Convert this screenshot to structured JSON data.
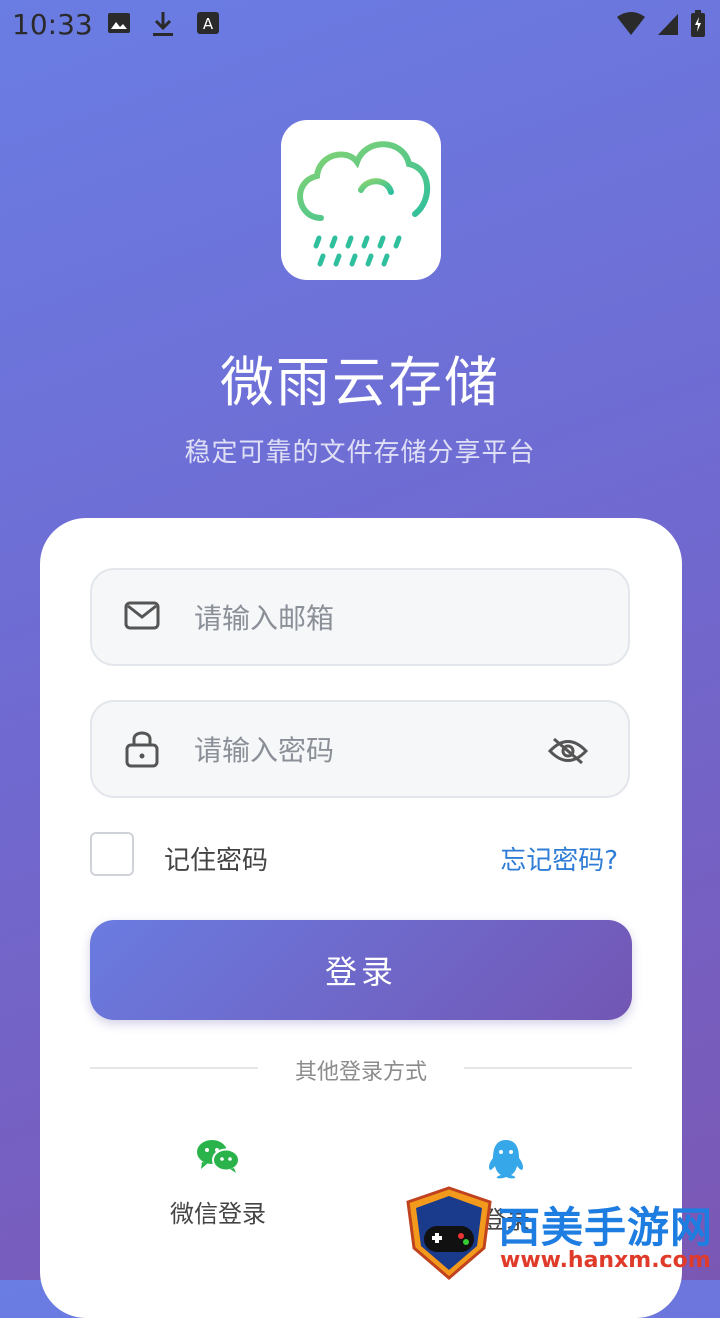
{
  "status_bar": {
    "time": "10:33",
    "icons": [
      "image-icon",
      "download-icon",
      "a-badge-icon",
      "wifi-icon",
      "signal-icon",
      "battery-icon"
    ]
  },
  "app": {
    "title": "微雨云存储",
    "subtitle": "稳定可靠的文件存储分享平台",
    "logo_icon": "rain-cloud-icon"
  },
  "form": {
    "email_placeholder": "请输入邮箱",
    "email_value": "",
    "password_placeholder": "请输入密码",
    "password_value": "",
    "remember_label": "记住密码",
    "remember_checked": false,
    "forgot_label": "忘记密码?",
    "login_label": "登录"
  },
  "other_login": {
    "divider_text": "其他登录方式",
    "wechat_label": "微信登录",
    "qq_label": "登录"
  },
  "watermark": {
    "text": "西美手游网",
    "url": "www.hanxm.com"
  },
  "colors": {
    "accent_blue": "#2f7dd6",
    "gradient_start": "#6a7de3",
    "gradient_end": "#7b57b4",
    "wechat_green": "#2ab34b",
    "qq_blue": "#36a7e8",
    "logo_green": "#7fd26f",
    "logo_teal": "#2fbf9d"
  }
}
